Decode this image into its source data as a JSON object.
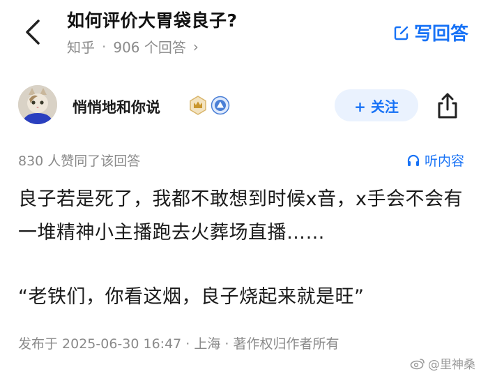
{
  "header": {
    "question_title": "如何评价大胃袋良子?",
    "source": "知乎",
    "separator": "·",
    "answer_count": "906 个回答",
    "chevron": "›",
    "write_answer_label": "写回答"
  },
  "author": {
    "name": "悄悄地和你说",
    "follow_label": "+ 关注"
  },
  "stats": {
    "likes": "830 人赞同了该回答",
    "listen_label": "听内容"
  },
  "answer": {
    "paragraph_1": "良子若是死了，我都不敢想到时候x音，x手会不会有一堆精神小主播跑去火葬场直播……",
    "paragraph_2": "“老铁们，你看这烟，良子烧起来就是旺”"
  },
  "footer": {
    "post_meta": "发布于 2025-06-30 16:47 · 上海 · 著作权归作者所有",
    "watermark": "@里神桑"
  },
  "colors": {
    "accent": "#1772f6",
    "follow_bg": "#eaf2fe",
    "meta_gray": "#8a8a8a"
  },
  "icons": [
    "back-arrow-icon",
    "edit-icon",
    "crown-badge-icon",
    "verified-badge-icon",
    "share-icon",
    "headphones-icon",
    "weibo-icon"
  ]
}
